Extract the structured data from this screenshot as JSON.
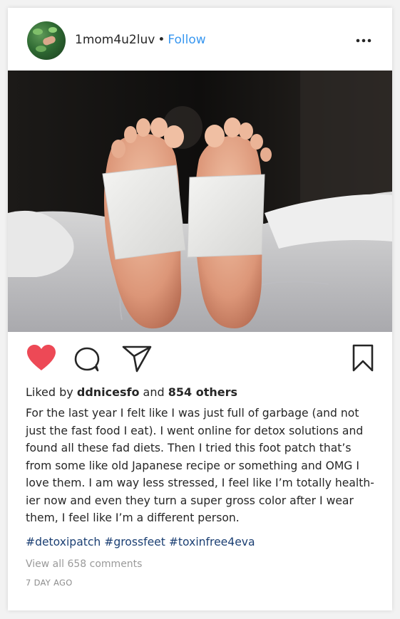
{
  "post": {
    "username": "1mom4u2luv",
    "separator": "•",
    "follow_label": "Follow",
    "liked_by_prefix": "Liked by",
    "liked_by_user": "ddnicesfo",
    "liked_by_and": "and",
    "liked_by_others": "854 others",
    "caption": "For the last year I felt like I was just full of garbage (and not just the fast food I eat). I went online for detox solutions and found all these fad diets. Then I tried this foot patch that’s from some like old Japanese recipe or something and OMG I love them. I am way less stressed, I feel like I’m totally health-ier now and even they turn a super gross color after I wear them, I feel like I’m a different person.",
    "hashtags": "#detoxipatch #grossfeet #toxinfree4eva",
    "view_all_comments": "View all 658 comments",
    "time_ago": "7 DAY AGO"
  },
  "icons": {
    "more": "more-options-icon",
    "like": "heart-icon",
    "comment": "comment-icon",
    "share": "paper-plane-icon",
    "save": "bookmark-icon"
  },
  "colors": {
    "follow": "#3897f0",
    "heart": "#ed4956",
    "hashtag": "#1b3f73",
    "muted": "#9a9a9a"
  }
}
